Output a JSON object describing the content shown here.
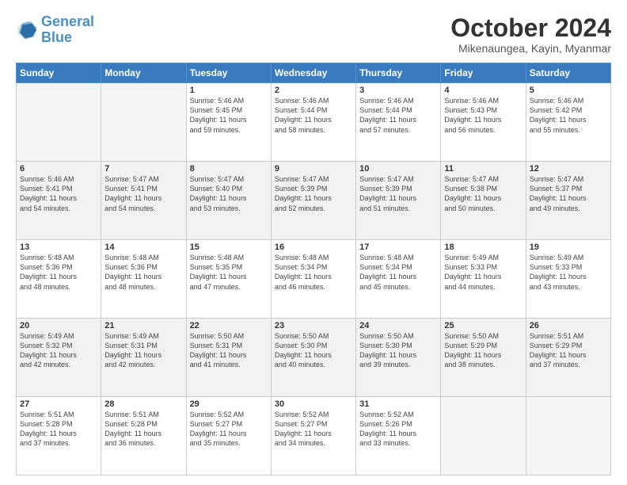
{
  "header": {
    "logo_line1": "General",
    "logo_line2": "Blue",
    "month": "October 2024",
    "location": "Mikenaungea, Kayin, Myanmar"
  },
  "weekdays": [
    "Sunday",
    "Monday",
    "Tuesday",
    "Wednesday",
    "Thursday",
    "Friday",
    "Saturday"
  ],
  "rows": [
    [
      {
        "day": "",
        "content": ""
      },
      {
        "day": "",
        "content": ""
      },
      {
        "day": "1",
        "content": "Sunrise: 5:46 AM\nSunset: 5:45 PM\nDaylight: 11 hours\nand 59 minutes."
      },
      {
        "day": "2",
        "content": "Sunrise: 5:46 AM\nSunset: 5:44 PM\nDaylight: 11 hours\nand 58 minutes."
      },
      {
        "day": "3",
        "content": "Sunrise: 5:46 AM\nSunset: 5:44 PM\nDaylight: 11 hours\nand 57 minutes."
      },
      {
        "day": "4",
        "content": "Sunrise: 5:46 AM\nSunset: 5:43 PM\nDaylight: 11 hours\nand 56 minutes."
      },
      {
        "day": "5",
        "content": "Sunrise: 5:46 AM\nSunset: 5:42 PM\nDaylight: 11 hours\nand 55 minutes."
      }
    ],
    [
      {
        "day": "6",
        "content": "Sunrise: 5:46 AM\nSunset: 5:41 PM\nDaylight: 11 hours\nand 54 minutes."
      },
      {
        "day": "7",
        "content": "Sunrise: 5:47 AM\nSunset: 5:41 PM\nDaylight: 11 hours\nand 54 minutes."
      },
      {
        "day": "8",
        "content": "Sunrise: 5:47 AM\nSunset: 5:40 PM\nDaylight: 11 hours\nand 53 minutes."
      },
      {
        "day": "9",
        "content": "Sunrise: 5:47 AM\nSunset: 5:39 PM\nDaylight: 11 hours\nand 52 minutes."
      },
      {
        "day": "10",
        "content": "Sunrise: 5:47 AM\nSunset: 5:39 PM\nDaylight: 11 hours\nand 51 minutes."
      },
      {
        "day": "11",
        "content": "Sunrise: 5:47 AM\nSunset: 5:38 PM\nDaylight: 11 hours\nand 50 minutes."
      },
      {
        "day": "12",
        "content": "Sunrise: 5:47 AM\nSunset: 5:37 PM\nDaylight: 11 hours\nand 49 minutes."
      }
    ],
    [
      {
        "day": "13",
        "content": "Sunrise: 5:48 AM\nSunset: 5:36 PM\nDaylight: 11 hours\nand 48 minutes."
      },
      {
        "day": "14",
        "content": "Sunrise: 5:48 AM\nSunset: 5:36 PM\nDaylight: 11 hours\nand 48 minutes."
      },
      {
        "day": "15",
        "content": "Sunrise: 5:48 AM\nSunset: 5:35 PM\nDaylight: 11 hours\nand 47 minutes."
      },
      {
        "day": "16",
        "content": "Sunrise: 5:48 AM\nSunset: 5:34 PM\nDaylight: 11 hours\nand 46 minutes."
      },
      {
        "day": "17",
        "content": "Sunrise: 5:48 AM\nSunset: 5:34 PM\nDaylight: 11 hours\nand 45 minutes."
      },
      {
        "day": "18",
        "content": "Sunrise: 5:49 AM\nSunset: 5:33 PM\nDaylight: 11 hours\nand 44 minutes."
      },
      {
        "day": "19",
        "content": "Sunrise: 5:49 AM\nSunset: 5:33 PM\nDaylight: 11 hours\nand 43 minutes."
      }
    ],
    [
      {
        "day": "20",
        "content": "Sunrise: 5:49 AM\nSunset: 5:32 PM\nDaylight: 11 hours\nand 42 minutes."
      },
      {
        "day": "21",
        "content": "Sunrise: 5:49 AM\nSunset: 5:31 PM\nDaylight: 11 hours\nand 42 minutes."
      },
      {
        "day": "22",
        "content": "Sunrise: 5:50 AM\nSunset: 5:31 PM\nDaylight: 11 hours\nand 41 minutes."
      },
      {
        "day": "23",
        "content": "Sunrise: 5:50 AM\nSunset: 5:30 PM\nDaylight: 11 hours\nand 40 minutes."
      },
      {
        "day": "24",
        "content": "Sunrise: 5:50 AM\nSunset: 5:30 PM\nDaylight: 11 hours\nand 39 minutes."
      },
      {
        "day": "25",
        "content": "Sunrise: 5:50 AM\nSunset: 5:29 PM\nDaylight: 11 hours\nand 38 minutes."
      },
      {
        "day": "26",
        "content": "Sunrise: 5:51 AM\nSunset: 5:29 PM\nDaylight: 11 hours\nand 37 minutes."
      }
    ],
    [
      {
        "day": "27",
        "content": "Sunrise: 5:51 AM\nSunset: 5:28 PM\nDaylight: 11 hours\nand 37 minutes."
      },
      {
        "day": "28",
        "content": "Sunrise: 5:51 AM\nSunset: 5:28 PM\nDaylight: 11 hours\nand 36 minutes."
      },
      {
        "day": "29",
        "content": "Sunrise: 5:52 AM\nSunset: 5:27 PM\nDaylight: 11 hours\nand 35 minutes."
      },
      {
        "day": "30",
        "content": "Sunrise: 5:52 AM\nSunset: 5:27 PM\nDaylight: 11 hours\nand 34 minutes."
      },
      {
        "day": "31",
        "content": "Sunrise: 5:52 AM\nSunset: 5:26 PM\nDaylight: 11 hours\nand 33 minutes."
      },
      {
        "day": "",
        "content": ""
      },
      {
        "day": "",
        "content": ""
      }
    ]
  ]
}
